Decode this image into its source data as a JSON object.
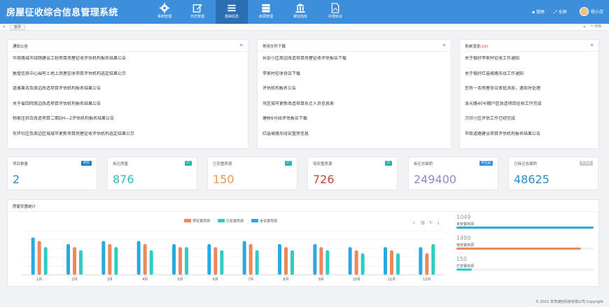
{
  "header": {
    "title": "房屋征收综合信息管理系统",
    "nav": [
      {
        "label": "系统管理",
        "icon": "gear-icon"
      },
      {
        "label": "日志管理",
        "icon": "edit-icon"
      },
      {
        "label": "基础信息",
        "icon": "list-icon"
      },
      {
        "label": "房源管理",
        "icon": "database-icon"
      },
      {
        "label": "被征收房",
        "icon": "bank-icon"
      },
      {
        "label": "补偿协议",
        "icon": "pdf-icon"
      }
    ],
    "lock_label": "锁屏",
    "fullscreen_label": "全屏",
    "user_name": "杨小尧"
  },
  "tabbar": {
    "home_tab": "首页",
    "refresh_label": "刷新",
    "left_arrow": "«",
    "right_arrow": "»"
  },
  "panels": {
    "notice": {
      "title": "通知公告",
      "items": [
        "华商路城市绿荫建设工程项目房屋征收评估机构报名结果公告",
        "敦煌信息中心围有土地上房屋征收项目评估机构选定结果公示",
        "道雅果去及周边改造项目评估机构报名结果公告",
        "关于省四院周边改造项目评估机构报名结果公告",
        "杨家庄综合改造项目二期DH—2评估机构报名结果公告",
        "东环社区及周边区城城市更新项目房屋征收评估机构选定结果公示"
      ]
    },
    "downloads": {
      "title": "常用文件下载",
      "items": [
        "长安小区周边改造项目房屋征收评估报告下载",
        "李家村征收协议下载",
        "评估机构报名公告",
        "东区城市更新改造项目拆迁人员信息表",
        "塘桥6号线评估报告下载",
        "红庙坡路东段安置房信息"
      ]
    },
    "messages": {
      "title": "系统消息",
      "count": "(10)",
      "items": [
        "关于做好李家村征收工作通知",
        "关于做好红庙坡路东段工作通知",
        "您有一条房屋协议审批消息，遇及时处理",
        "含元路40号棚户区改造项目征收工作完成",
        "方欣小区评估工作已经完成",
        "市政道路建设项目评估机构报名结果公告"
      ]
    }
  },
  "stats": [
    {
      "label": "项目数量",
      "badge": "所有",
      "value": "2",
      "badge_color": "#1f7fbf",
      "value_color": "#2b8cc8"
    },
    {
      "label": "拆迁房屋",
      "badge": "户",
      "value": "876",
      "badge_color": "#26b5b0",
      "value_color": "#2fbdb8"
    },
    {
      "label": "已安置房源",
      "badge": "户",
      "value": "150",
      "badge_color": "#26b5b0",
      "value_color": "#f0964a"
    },
    {
      "label": "待安置房源",
      "badge": "户",
      "value": "726",
      "badge_color": "#26b5b0",
      "value_color": "#c8433b"
    },
    {
      "label": "拆迁总面积",
      "badge": "平方米",
      "value": "249400",
      "badge_color": "#3d8fdb",
      "value_color": "#8a8fc4"
    },
    {
      "label": "已拆迁总面积",
      "badge": "平方米",
      "value": "48625",
      "badge_color": "#c8ccd2",
      "value_color": "#2b8cc8"
    }
  ],
  "chart_panel": {
    "title": "房屋安置统计",
    "tools": [
      "line-chart-icon",
      "bar-chart-icon",
      "restore-icon",
      "download-icon"
    ]
  },
  "chart_data": {
    "type": "bar",
    "categories": [
      "1月",
      "2月",
      "3月",
      "4月",
      "5月",
      "6月",
      "7月",
      "8月",
      "9月",
      "10月",
      "11月",
      "12月"
    ],
    "series": [
      {
        "name": "未安置房源",
        "color": "#29a9e0",
        "values": [
          85,
          70,
          77,
          77,
          70,
          70,
          77,
          70,
          70,
          63,
          63,
          63
        ]
      },
      {
        "name": "待安置房源",
        "color": "#f0865c",
        "values": [
          77,
          63,
          70,
          70,
          63,
          63,
          70,
          63,
          63,
          56,
          56,
          49
        ]
      },
      {
        "name": "已安置房源",
        "color": "#2ccdc2",
        "values": [
          63,
          56,
          63,
          56,
          63,
          56,
          56,
          56,
          56,
          49,
          49,
          70
        ]
      }
    ],
    "legend_order": [
      "待安置房源",
      "已安置房源",
      "未安置房源"
    ],
    "ylim": [
      0,
      100
    ],
    "grid": true,
    "legend": "top-center",
    "xlabel": "",
    "ylabel": ""
  },
  "progress": [
    {
      "value": "1049",
      "label": "未安置房源",
      "color": "#29a9e0",
      "percent": 100
    },
    {
      "value": "1490",
      "label": "待安置房源",
      "color": "#f0865c",
      "percent": 91
    },
    {
      "value": "150",
      "label": "已安置房源",
      "color": "#2ccdc2",
      "percent": 11
    }
  ],
  "footer": "© 2021 甘肃诚旺科技有限公司 Copyright"
}
